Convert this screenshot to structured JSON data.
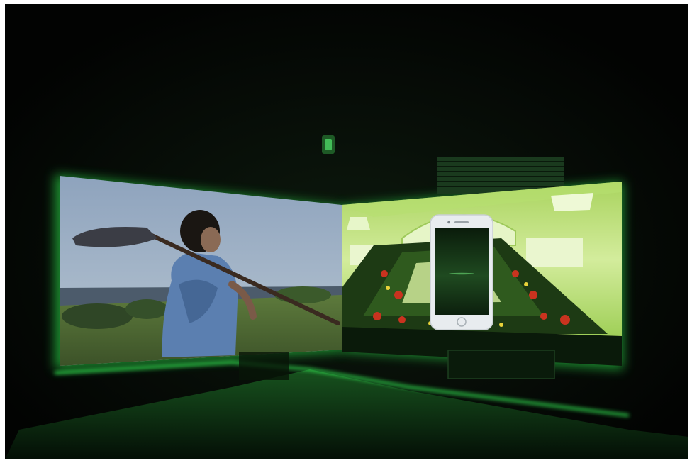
{
  "photo": {
    "subject": "video-installation-room",
    "colors": {
      "background": "#ffffff",
      "room": "#030503",
      "led_glow": "#33ff55",
      "floor": "#0b2a0f",
      "sky": "#9fb4c9",
      "sea": "#4c5b6b",
      "grass": "#4c6a35",
      "bedroom_tint": "#bfe07a",
      "rug": "#1d3a14",
      "phone_body": "#e8ecef",
      "phone_screen": "#0f2a12"
    },
    "icons": {
      "exit_sign": "exit-sign-icon",
      "vent": "air-vent-icon"
    }
  }
}
